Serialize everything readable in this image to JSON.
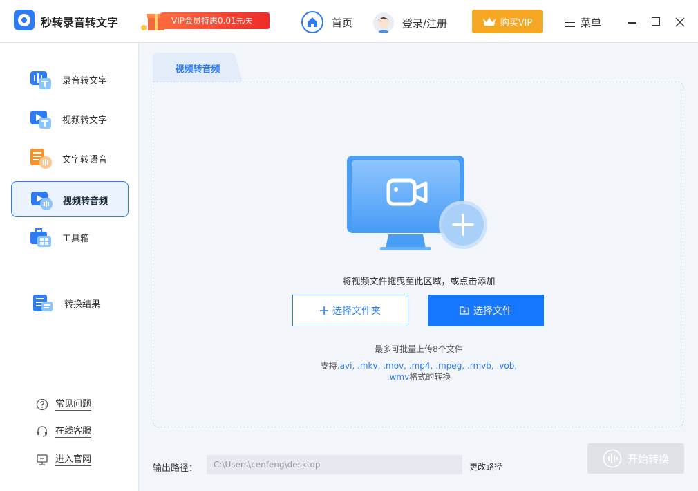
{
  "header": {
    "app_title": "秒转录音转文字",
    "promo_text": "VIP会员特惠0.01",
    "promo_unit": "元/天",
    "home_label": "首页",
    "login_label": "登录/注册",
    "vip_label": "购买VIP",
    "menu_label": "菜单"
  },
  "sidebar": {
    "items": [
      {
        "label": "录音转文字",
        "icon": "audio-to-text-icon"
      },
      {
        "label": "视频转文字",
        "icon": "video-to-text-icon"
      },
      {
        "label": "文字转语音",
        "icon": "text-to-speech-icon"
      },
      {
        "label": "视频转音频",
        "icon": "video-to-audio-icon",
        "active": true
      },
      {
        "label": "工具箱",
        "icon": "toolbox-icon"
      },
      {
        "label": "转换结果",
        "icon": "results-icon"
      }
    ],
    "help": [
      {
        "label": "常见问题",
        "icon": "question-icon"
      },
      {
        "label": "在线客服",
        "icon": "headset-icon"
      },
      {
        "label": "进入官网",
        "icon": "monitor-icon"
      }
    ]
  },
  "main": {
    "tab_label": "视频转音频",
    "drop_hint": "将视频文件拖曳至此区域，或点击添加",
    "select_folder_label": "选择文件夹",
    "select_file_label": "选择文件",
    "batch_note": "最多可批量上传8个文件",
    "formats_prefix": "支持",
    "formats_line1": ".avi, .mkv, .mov, .mp4, .mpeg, .rmvb, .vob,",
    "formats_line2": ".wmv",
    "formats_suffix": "格式的转换",
    "output_label": "输出路径：",
    "output_path": "C:\\Users\\cenfeng\\desktop",
    "change_path_label": "更改路径",
    "start_label": "开始转换"
  },
  "colors": {
    "accent": "#2d7cf6",
    "primary_button": "#1677ff",
    "vip": "#f5a623",
    "promo": "#ef2b2b",
    "disabled": "#dfe3e8"
  }
}
